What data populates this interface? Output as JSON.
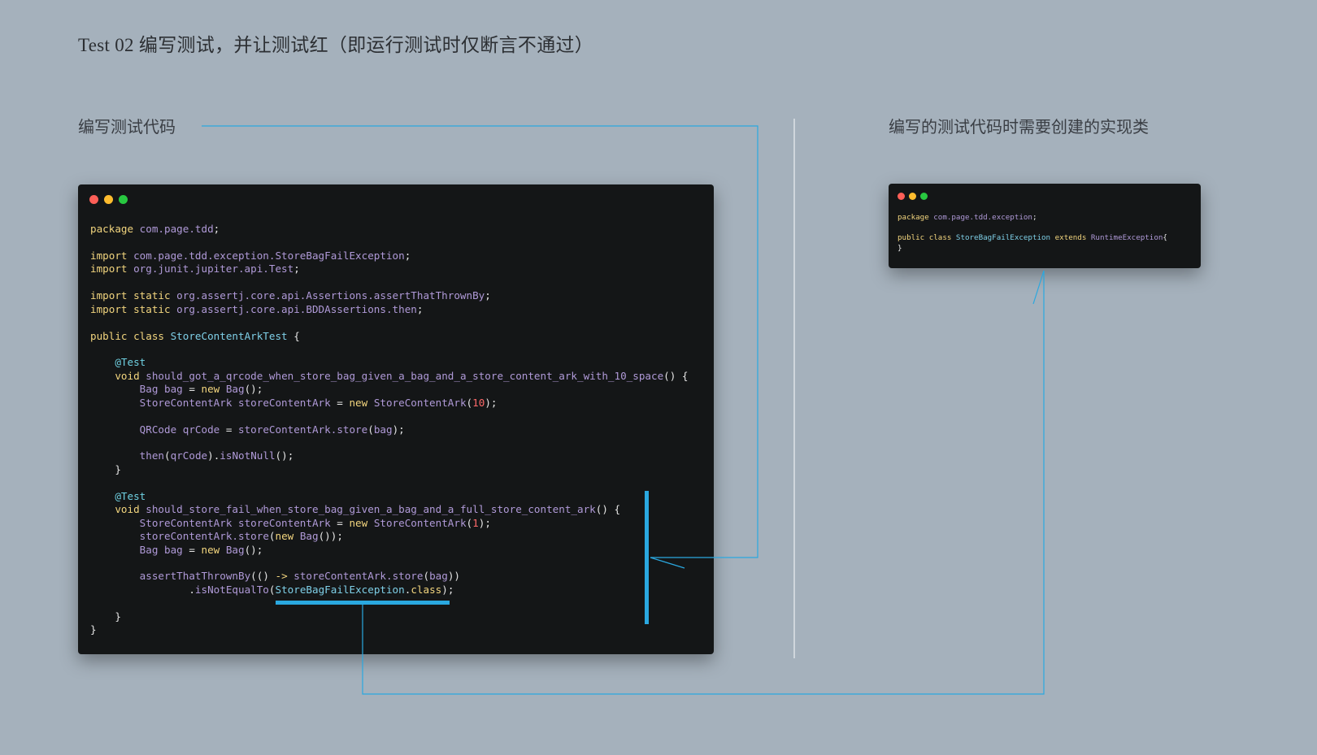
{
  "title": "Test 02 编写测试，并让测试红（即运行测试时仅断言不通过）",
  "left_label": "编写测试代码",
  "right_label": "编写的测试代码时需要创建的实现类",
  "colors": {
    "background": "#a5b1bc",
    "connector": "#2aa8e0",
    "window_bg": "#141617",
    "keyword": "#f2d57e",
    "namespace": "#b09ad8",
    "type": "#7fd0e8",
    "annotation": "#6fd1e2",
    "number": "#ff6a6a"
  },
  "test_code": [
    [
      [
        "kw",
        "package "
      ],
      [
        "ns",
        "com.page.tdd"
      ],
      [
        "pl",
        ";"
      ]
    ],
    [],
    [
      [
        "kw",
        "import "
      ],
      [
        "ns",
        "com.page.tdd.exception.StoreBagFailException"
      ],
      [
        "pl",
        ";"
      ]
    ],
    [
      [
        "kw",
        "import "
      ],
      [
        "ns",
        "org.junit.jupiter.api.Test"
      ],
      [
        "pl",
        ";"
      ]
    ],
    [],
    [
      [
        "kw",
        "import static "
      ],
      [
        "ns",
        "org.assertj.core.api.Assertions.assertThatThrownBy"
      ],
      [
        "pl",
        ";"
      ]
    ],
    [
      [
        "kw",
        "import static "
      ],
      [
        "ns",
        "org.assertj.core.api.BDDAssertions.then"
      ],
      [
        "pl",
        ";"
      ]
    ],
    [],
    [
      [
        "kw",
        "public class "
      ],
      [
        "ty",
        "StoreContentArkTest"
      ],
      [
        "pl",
        " {"
      ]
    ],
    [],
    [
      [
        "pl",
        "    "
      ],
      [
        "an",
        "@Test"
      ]
    ],
    [
      [
        "pl",
        "    "
      ],
      [
        "kw",
        "void "
      ],
      [
        "ns",
        "should_got_a_qrcode_when_store_bag_given_a_bag_and_a_store_content_ark_with_10_space"
      ],
      [
        "pl",
        "() {"
      ]
    ],
    [
      [
        "pl",
        "        "
      ],
      [
        "ns",
        "Bag bag"
      ],
      [
        "pl",
        " = "
      ],
      [
        "kw",
        "new "
      ],
      [
        "ns",
        "Bag"
      ],
      [
        "pl",
        "();"
      ]
    ],
    [
      [
        "pl",
        "        "
      ],
      [
        "ns",
        "StoreContentArk storeContentArk"
      ],
      [
        "pl",
        " = "
      ],
      [
        "kw",
        "new "
      ],
      [
        "ns",
        "StoreContentArk"
      ],
      [
        "pl",
        "("
      ],
      [
        "nm",
        "10"
      ],
      [
        "pl",
        ");"
      ]
    ],
    [],
    [
      [
        "pl",
        "        "
      ],
      [
        "ns",
        "QRCode qrCode"
      ],
      [
        "pl",
        " = "
      ],
      [
        "ns",
        "storeContentArk.store"
      ],
      [
        "pl",
        "("
      ],
      [
        "ns",
        "bag"
      ],
      [
        "pl",
        ");"
      ]
    ],
    [],
    [
      [
        "pl",
        "        "
      ],
      [
        "ns",
        "then"
      ],
      [
        "pl",
        "("
      ],
      [
        "ns",
        "qrCode"
      ],
      [
        "pl",
        ")."
      ],
      [
        "ns",
        "isNotNull"
      ],
      [
        "pl",
        "();"
      ]
    ],
    [
      [
        "pl",
        "    }"
      ]
    ],
    [],
    [
      [
        "pl",
        "    "
      ],
      [
        "an",
        "@Test"
      ]
    ],
    [
      [
        "pl",
        "    "
      ],
      [
        "kw",
        "void "
      ],
      [
        "ns",
        "should_store_fail_when_store_bag_given_a_bag_and_a_full_store_content_ark"
      ],
      [
        "pl",
        "() {"
      ]
    ],
    [
      [
        "pl",
        "        "
      ],
      [
        "ns",
        "StoreContentArk storeContentArk"
      ],
      [
        "pl",
        " = "
      ],
      [
        "kw",
        "new "
      ],
      [
        "ns",
        "StoreContentArk"
      ],
      [
        "pl",
        "("
      ],
      [
        "nm",
        "1"
      ],
      [
        "pl",
        ");"
      ]
    ],
    [
      [
        "pl",
        "        "
      ],
      [
        "ns",
        "storeContentArk.store"
      ],
      [
        "pl",
        "("
      ],
      [
        "kw",
        "new "
      ],
      [
        "ns",
        "Bag"
      ],
      [
        "pl",
        "());"
      ]
    ],
    [
      [
        "pl",
        "        "
      ],
      [
        "ns",
        "Bag bag"
      ],
      [
        "pl",
        " = "
      ],
      [
        "kw",
        "new "
      ],
      [
        "ns",
        "Bag"
      ],
      [
        "pl",
        "();"
      ]
    ],
    [],
    [
      [
        "pl",
        "        "
      ],
      [
        "ns",
        "assertThatThrownBy"
      ],
      [
        "pl",
        "(() "
      ],
      [
        "kw",
        "-> "
      ],
      [
        "ns",
        "storeContentArk.store"
      ],
      [
        "pl",
        "("
      ],
      [
        "ns",
        "bag"
      ],
      [
        "pl",
        "))"
      ]
    ],
    [
      [
        "pl",
        "                ."
      ],
      [
        "ns",
        "isNotEqualTo"
      ],
      [
        "pl",
        "("
      ],
      [
        "ty",
        "StoreBagFailException"
      ],
      [
        "pl",
        "."
      ],
      [
        "kw",
        "class"
      ],
      [
        "pl",
        ");"
      ]
    ],
    [],
    [
      [
        "pl",
        "    }"
      ]
    ],
    [
      [
        "pl",
        "}"
      ]
    ]
  ],
  "impl_code": [
    [
      [
        "kw",
        "package "
      ],
      [
        "ns",
        "com.page.tdd.exception"
      ],
      [
        "pl",
        ";"
      ]
    ],
    [],
    [
      [
        "kw",
        "public class "
      ],
      [
        "ty",
        "StoreBagFailException "
      ],
      [
        "kw",
        "extends "
      ],
      [
        "ns",
        "RuntimeException"
      ],
      [
        "pl",
        "{"
      ]
    ],
    [
      [
        "pl",
        "}"
      ]
    ]
  ]
}
